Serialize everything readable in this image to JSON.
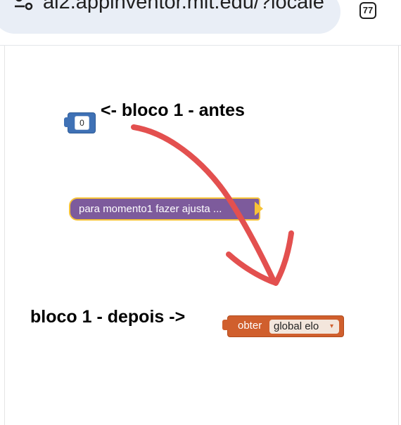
{
  "browser": {
    "url": "ai2.appinventor.mit.edu/?locale",
    "tab_count": "77",
    "tune_icon": "site-settings-icon"
  },
  "annotations": {
    "before": "<- bloco 1 - antes",
    "after": "bloco 1 - depois ->"
  },
  "blocks": {
    "number": {
      "value": "0",
      "color": "#3f71b5"
    },
    "procedure_call": {
      "label": "para momento1 fazer ajusta ...",
      "color": "#7d5b9c",
      "border_color": "#f7c338"
    },
    "getter": {
      "label": "obter",
      "variable": "global elo",
      "dropdown_arrow": "▾",
      "color": "#d05f2d"
    }
  },
  "drawing": {
    "arrow_color": "#e3504f"
  }
}
